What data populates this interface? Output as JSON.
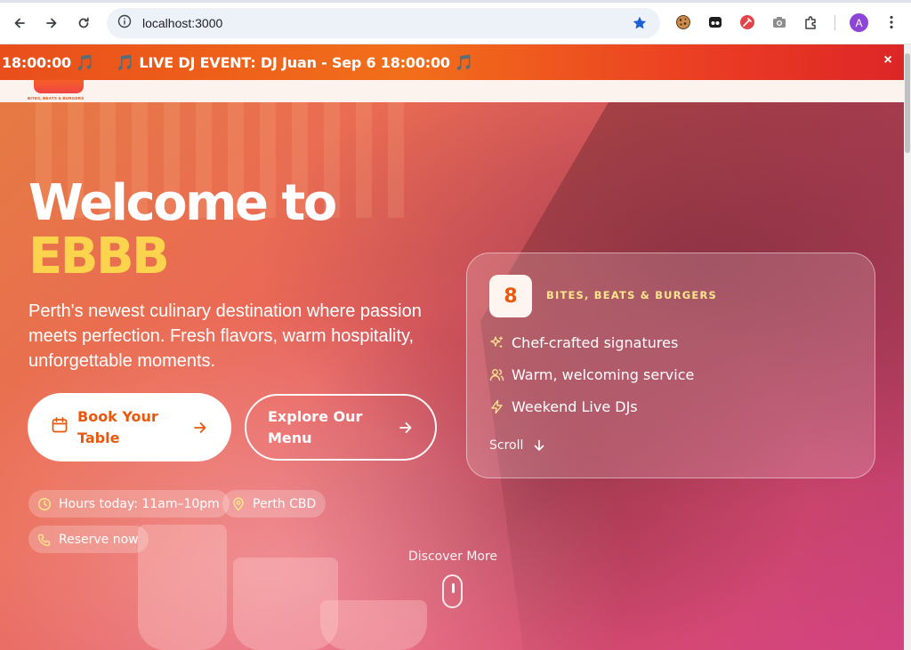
{
  "browser": {
    "url": "localhost:3000",
    "profile_initial": "A",
    "icons": [
      "back-icon",
      "forward-icon",
      "reload-icon",
      "site-info-icon",
      "bookmark-star-icon",
      "cookie-extension-icon",
      "dark-reader-extension-icon",
      "color-picker-extension-icon",
      "screenshot-extension-icon",
      "extensions-puzzle-icon",
      "more-menu-icon"
    ]
  },
  "announcement": {
    "segment_1": "18:00:00",
    "segment_2": "LIVE DJ EVENT: DJ Juan - Sep 6 18:00:00",
    "note_glyph": "🎵",
    "close_label": "×"
  },
  "header": {
    "logo_caption": "BITES, BEATS & BURGERS"
  },
  "hero": {
    "title_line1": "Welcome to",
    "title_line2": "EBBB",
    "subtitle": "Perth's newest culinary destination where passion meets perfection. Fresh flavors, warm hospitality, unforgettable moments.",
    "primary_cta": "Book Your Table",
    "secondary_cta": "Explore Our Menu",
    "chips": {
      "hours": "Hours today: 11am–10pm",
      "location": "Perth CBD",
      "reserve": "Reserve now"
    },
    "discover": "Discover More"
  },
  "card": {
    "badge": "8",
    "kicker": "BITES, BEATS & BURGERS",
    "features": [
      {
        "label": "Chef-crafted signatures",
        "icon": "sparkles-icon"
      },
      {
        "label": "Warm, welcoming service",
        "icon": "users-icon"
      },
      {
        "label": "Weekend Live DJs",
        "icon": "zap-icon"
      }
    ],
    "scroll_label": "Scroll"
  },
  "colors": {
    "accent_orange": "#ea580c",
    "title_yellow": "#fcd34d",
    "kicker_yellow": "#fde68a",
    "banner_start": "#e94e1b",
    "banner_end": "#dc2626"
  }
}
